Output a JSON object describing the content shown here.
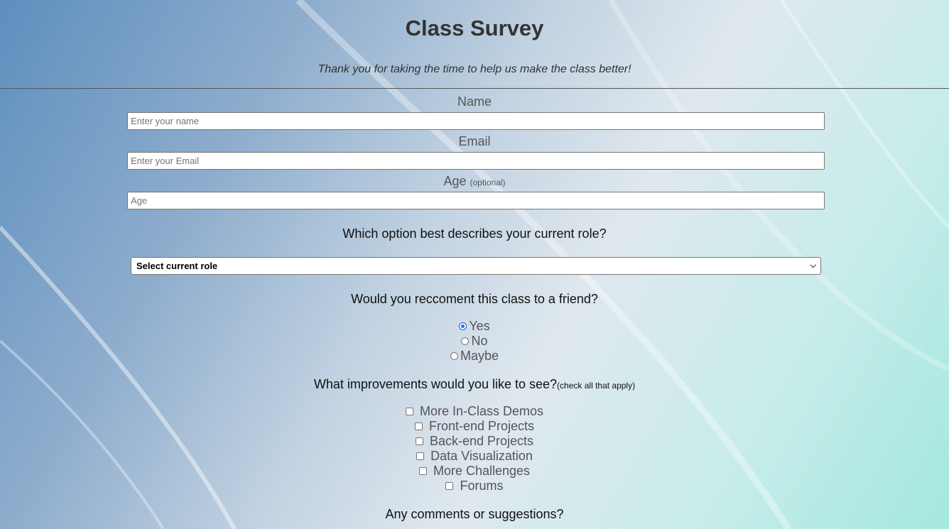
{
  "header": {
    "title": "Class Survey",
    "subtitle": "Thank you for taking the time to help us make the class better!"
  },
  "fields": {
    "name": {
      "label": "Name",
      "placeholder": "Enter your name"
    },
    "email": {
      "label": "Email",
      "placeholder": "Enter your Email"
    },
    "age": {
      "label": "Age",
      "hint": "(optional)",
      "placeholder": "Age"
    }
  },
  "role": {
    "question": "Which option best describes your current role?",
    "selected": "Select current role"
  },
  "recommend": {
    "question": "Would you reccoment this class to a friend?",
    "options": [
      {
        "label": "Yes",
        "checked": true
      },
      {
        "label": "No",
        "checked": false
      },
      {
        "label": "Maybe",
        "checked": false
      }
    ]
  },
  "improvements": {
    "question": "What improvements would you like to see?",
    "hint": "(check all that apply)",
    "options": [
      "More In-Class Demos",
      "Front-end Projects",
      "Back-end Projects",
      "Data Visualization",
      "More Challenges",
      "Forums"
    ]
  },
  "comments": {
    "question": "Any comments or suggestions?"
  },
  "colors": {
    "radio_checked": "#1f6fff",
    "heading": "#333333"
  }
}
